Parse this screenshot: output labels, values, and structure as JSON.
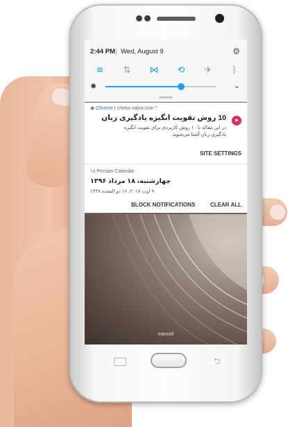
{
  "status_bar": {
    "time": "2:44 PM",
    "separator": "|",
    "date": "Wed, August 9",
    "settings_icon": "gear-icon"
  },
  "quick_settings": {
    "icons": [
      {
        "name": "wifi-icon",
        "glyph": "≋",
        "active": true,
        "color": "#1aa3e8"
      },
      {
        "name": "mobile-data-icon",
        "glyph": "⇅",
        "active": false,
        "color": "#9a9a9a"
      },
      {
        "name": "sound-off-icon",
        "glyph": "⋈",
        "active": true,
        "color": "#1aa3e8"
      },
      {
        "name": "auto-rotate-icon",
        "glyph": "⟲",
        "active": true,
        "color": "#1aa3e8"
      },
      {
        "name": "airplane-mode-icon",
        "glyph": "✈",
        "active": false,
        "color": "#9a9a9a"
      },
      {
        "name": "bluetooth-icon",
        "glyph": "ᛒ",
        "active": false,
        "color": "#9a9a9a"
      }
    ],
    "brightness": {
      "level": 0.68,
      "icon": "brightness-icon",
      "expand_icon": "chevron-down-icon",
      "accent": "#1aa3e8"
    }
  },
  "notifications": {
    "chrome": {
      "app": "Chrome",
      "source": "chetor.najva.com",
      "title": "10 روش تقویت انگیزه یادگیری زبان",
      "body": "در این مقاله با ۱۰ روش کاربردی برای تقویت انگیزه یادگیری زبان آشنا می‌شوید.",
      "action": "SITE SETTINGS",
      "logo_color": "#d2315c"
    },
    "calendar": {
      "count": "۱۸",
      "app": "Persian Calendar",
      "title": "چهارشنبه، ۱۸ مرداد ۱۳۹۶",
      "subtitle": "۹ اوت ۲۰۱۷، ۱۶ ذو القعده ۱۴۳۸",
      "block_label": "BLOCK NOTIFICATIONS",
      "clear_label": "CLEAR ALL"
    }
  },
  "lockscreen": {
    "carrier": "Irancell"
  }
}
